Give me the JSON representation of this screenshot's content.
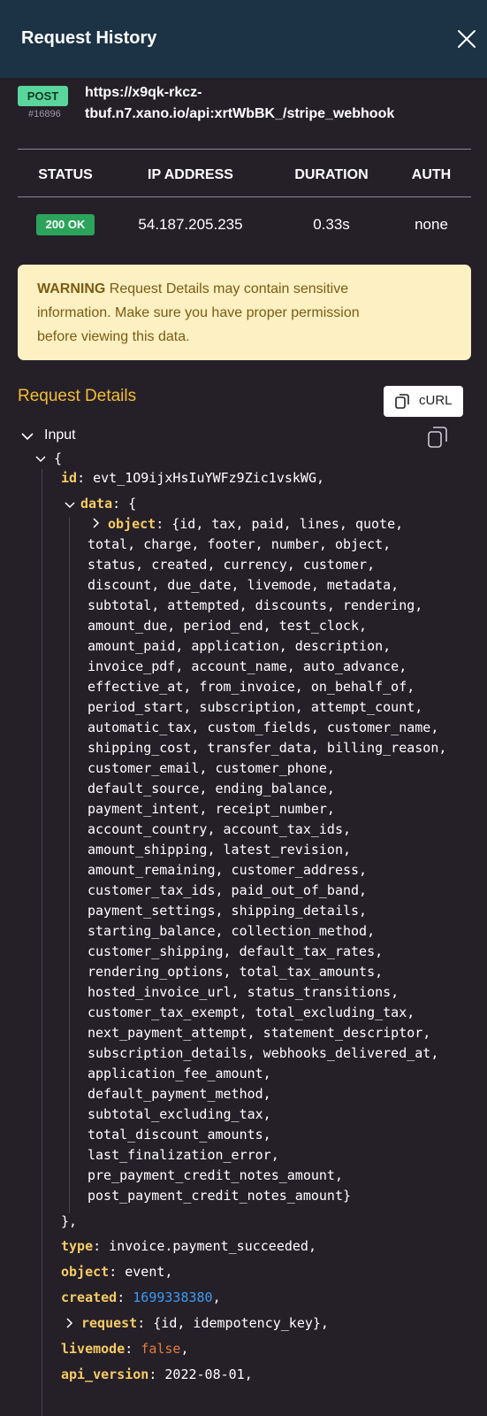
{
  "header": {
    "title": "Request History"
  },
  "request": {
    "method": "POST",
    "id": "#16896",
    "url_line1": "https://x9qk-rkcz-",
    "url_line2": "tbuf.n7.xano.io/api:xrtWbBK_/stripe_webhook"
  },
  "summary_table": {
    "columns": [
      "STATUS",
      "IP ADDRESS",
      "DURATION",
      "AUTH"
    ],
    "row": {
      "status": "200 OK",
      "ip": "54.187.205.235",
      "duration": "0.33s",
      "auth": "none"
    }
  },
  "warning": {
    "bold": "WARNING",
    "line1": " Request Details may contain sensitive",
    "line2": "information. Make sure you have proper permission",
    "line3": "before viewing this data."
  },
  "details": {
    "title": "Request Details",
    "curl_label": "cURL",
    "input_label": "Input"
  },
  "code": {
    "open_brace": "{",
    "id_key": "id",
    "id_value": ": evt_1O9ijxHsIuYWFz9Zic1vskWG,",
    "data_key": "data",
    "data_open": ": {",
    "object_key": "object",
    "object_lines": [
      ": {id, tax, paid, lines, quote,",
      "total, charge, footer, number, object,",
      "status, created, currency, customer,",
      "discount, due_date, livemode, metadata,",
      "subtotal, attempted, discounts, rendering,",
      "amount_due, period_end, test_clock,",
      "amount_paid, application, description,",
      "invoice_pdf, account_name, auto_advance,",
      "effective_at, from_invoice, on_behalf_of,",
      "period_start, subscription, attempt_count,",
      "automatic_tax, custom_fields, customer_name,",
      "shipping_cost, transfer_data, billing_reason,",
      "customer_email, customer_phone,",
      "default_source, ending_balance,",
      "payment_intent, receipt_number,",
      "account_country, account_tax_ids,",
      "amount_shipping, latest_revision,",
      "amount_remaining, customer_address,",
      "customer_tax_ids, paid_out_of_band,",
      "payment_settings, shipping_details,",
      "starting_balance, collection_method,",
      "customer_shipping, default_tax_rates,",
      "rendering_options, total_tax_amounts,",
      "hosted_invoice_url, status_transitions,",
      "customer_tax_exempt, total_excluding_tax,",
      "next_payment_attempt, statement_descriptor,",
      "subscription_details, webhooks_delivered_at,",
      "application_fee_amount,",
      "default_payment_method,",
      "subtotal_excluding_tax,",
      "total_discount_amounts,",
      "last_finalization_error,",
      "pre_payment_credit_notes_amount,",
      "post_payment_credit_notes_amount}"
    ],
    "data_close": "},",
    "type_key": "type",
    "type_value": ": invoice.payment_succeeded,",
    "object2_key": "object",
    "object2_value": ": event,",
    "created_key": "created",
    "created_value": "1699338380",
    "request_key": "request",
    "request_value": ": {id, idempotency_key},",
    "livemode_key": "livemode",
    "livemode_value": "false",
    "api_key": "api_version",
    "api_value": ": 2022-08-01,"
  },
  "icons": {
    "close": "close-icon",
    "copy": "copy-icon",
    "chevron_down": "chevron-down-icon",
    "chevron_right": "chevron-right-icon"
  },
  "colors": {
    "header_bg": "#1b3345",
    "body_bg": "#251f28",
    "accent": "#f3bd36",
    "ok": "#2ba35a",
    "post": "#5ad59b",
    "warning_bg": "#fdf0c3"
  }
}
